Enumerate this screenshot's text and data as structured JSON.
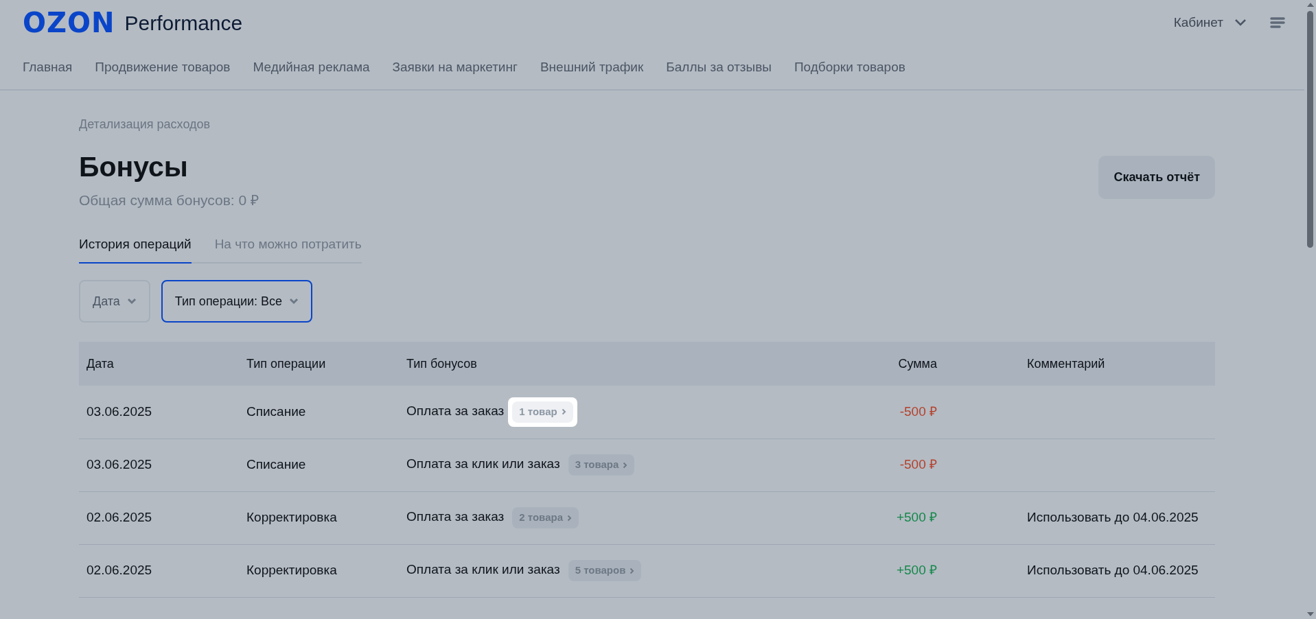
{
  "header": {
    "logo": "OZON",
    "product": "Performance",
    "account": "Кабинет"
  },
  "nav": [
    {
      "label": "Главная"
    },
    {
      "label": "Продвижение товаров"
    },
    {
      "label": "Медийная реклама"
    },
    {
      "label": "Заявки на маркетинг"
    },
    {
      "label": "Внешний трафик"
    },
    {
      "label": "Баллы за отзывы"
    },
    {
      "label": "Подборки товаров"
    }
  ],
  "breadcrumb": "Детализация расходов",
  "title": "Бонусы",
  "subtitle": "Общая сумма бонусов: 0 ₽",
  "download_button": "Скачать отчёт",
  "tabs": [
    {
      "label": "История операций",
      "selected": true
    },
    {
      "label": "На что можно потратить",
      "selected": false
    }
  ],
  "filters": [
    {
      "label": "Дата",
      "selected": false
    },
    {
      "label": "Тип операции: Все",
      "selected": true
    }
  ],
  "table": {
    "columns": [
      "Дата",
      "Тип операции",
      "Тип бонусов",
      "Сумма",
      "Комментарий"
    ],
    "rows": [
      {
        "date": "03.06.2025",
        "operation": "Списание",
        "bonus_type": "Оплата за заказ",
        "items": "1 товар",
        "highlighted": true,
        "amount": "-500 ₽",
        "kind": "debit"
      },
      {
        "date": "03.06.2025",
        "operation": "Списание",
        "bonus_type": "Оплата за клик или заказ",
        "items": "3 товара",
        "highlighted": false,
        "amount": "-500 ₽",
        "kind": "debit"
      },
      {
        "date": "02.06.2025",
        "operation": "Корректировка",
        "bonus_type": "Оплата за заказ",
        "items": "2 товара",
        "highlighted": false,
        "amount": "+500 ₽",
        "kind": "credit",
        "comment": "Использовать до 04.06.2025"
      },
      {
        "date": "02.06.2025",
        "operation": "Корректировка",
        "bonus_type": "Оплата за клик или заказ",
        "items": "5 товаров",
        "highlighted": false,
        "amount": "+500 ₽",
        "kind": "credit",
        "comment": "Использовать до 04.06.2025"
      }
    ]
  }
}
